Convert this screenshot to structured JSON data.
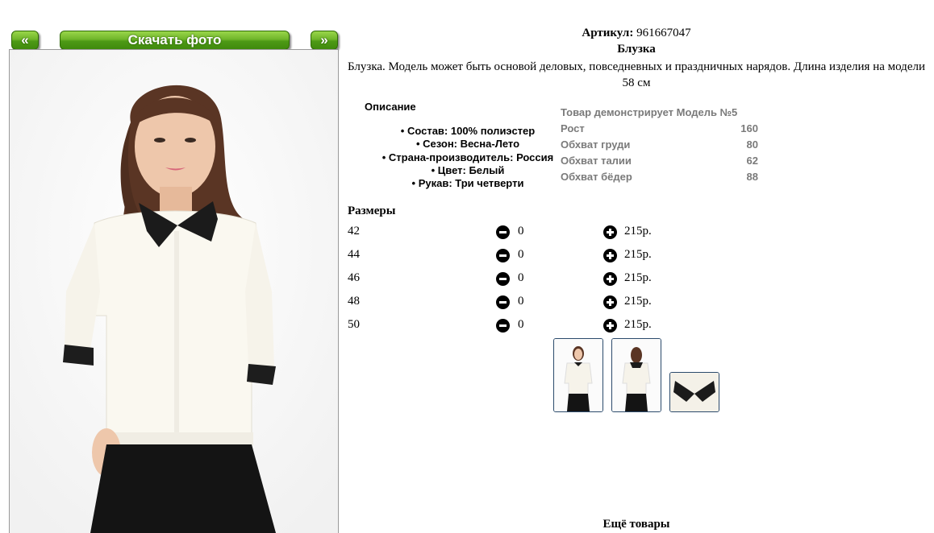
{
  "nav": {
    "prev_label": "«",
    "download_label": "Скачать фото",
    "next_label": "»"
  },
  "product": {
    "article_label": "Артикул:",
    "article_value": "961667047",
    "name": "Блузка",
    "description": "Блузка. Модель может быть основой деловых, повседневных и праздничных нарядов. Длина изделия на модели 58 см"
  },
  "details": {
    "title": "Описание",
    "items": [
      "Состав: 100% полиэстер",
      "Сезон: Весна-Лето",
      "Страна-производитель: Россия",
      "Цвет: Белый",
      "Рукав: Три четверти"
    ]
  },
  "model": {
    "header": "Товар демонстрирует Модель №5",
    "rows": [
      {
        "label": "Рост",
        "value": "160"
      },
      {
        "label": "Обхват груди",
        "value": "80"
      },
      {
        "label": "Обхват талии",
        "value": "62"
      },
      {
        "label": "Обхват бёдер",
        "value": "88"
      }
    ]
  },
  "sizes": {
    "title": "Размеры",
    "rows": [
      {
        "size": "42",
        "qty": "0",
        "price": "215р."
      },
      {
        "size": "44",
        "qty": "0",
        "price": "215р."
      },
      {
        "size": "46",
        "qty": "0",
        "price": "215р."
      },
      {
        "size": "48",
        "qty": "0",
        "price": "215р."
      },
      {
        "size": "50",
        "qty": "0",
        "price": "215р."
      }
    ]
  },
  "more_title": "Ещё товары",
  "colors": {
    "button_green": "#5aa51c",
    "muted_text": "#7a7a7a",
    "thumb_border": "#2b4a6b"
  }
}
